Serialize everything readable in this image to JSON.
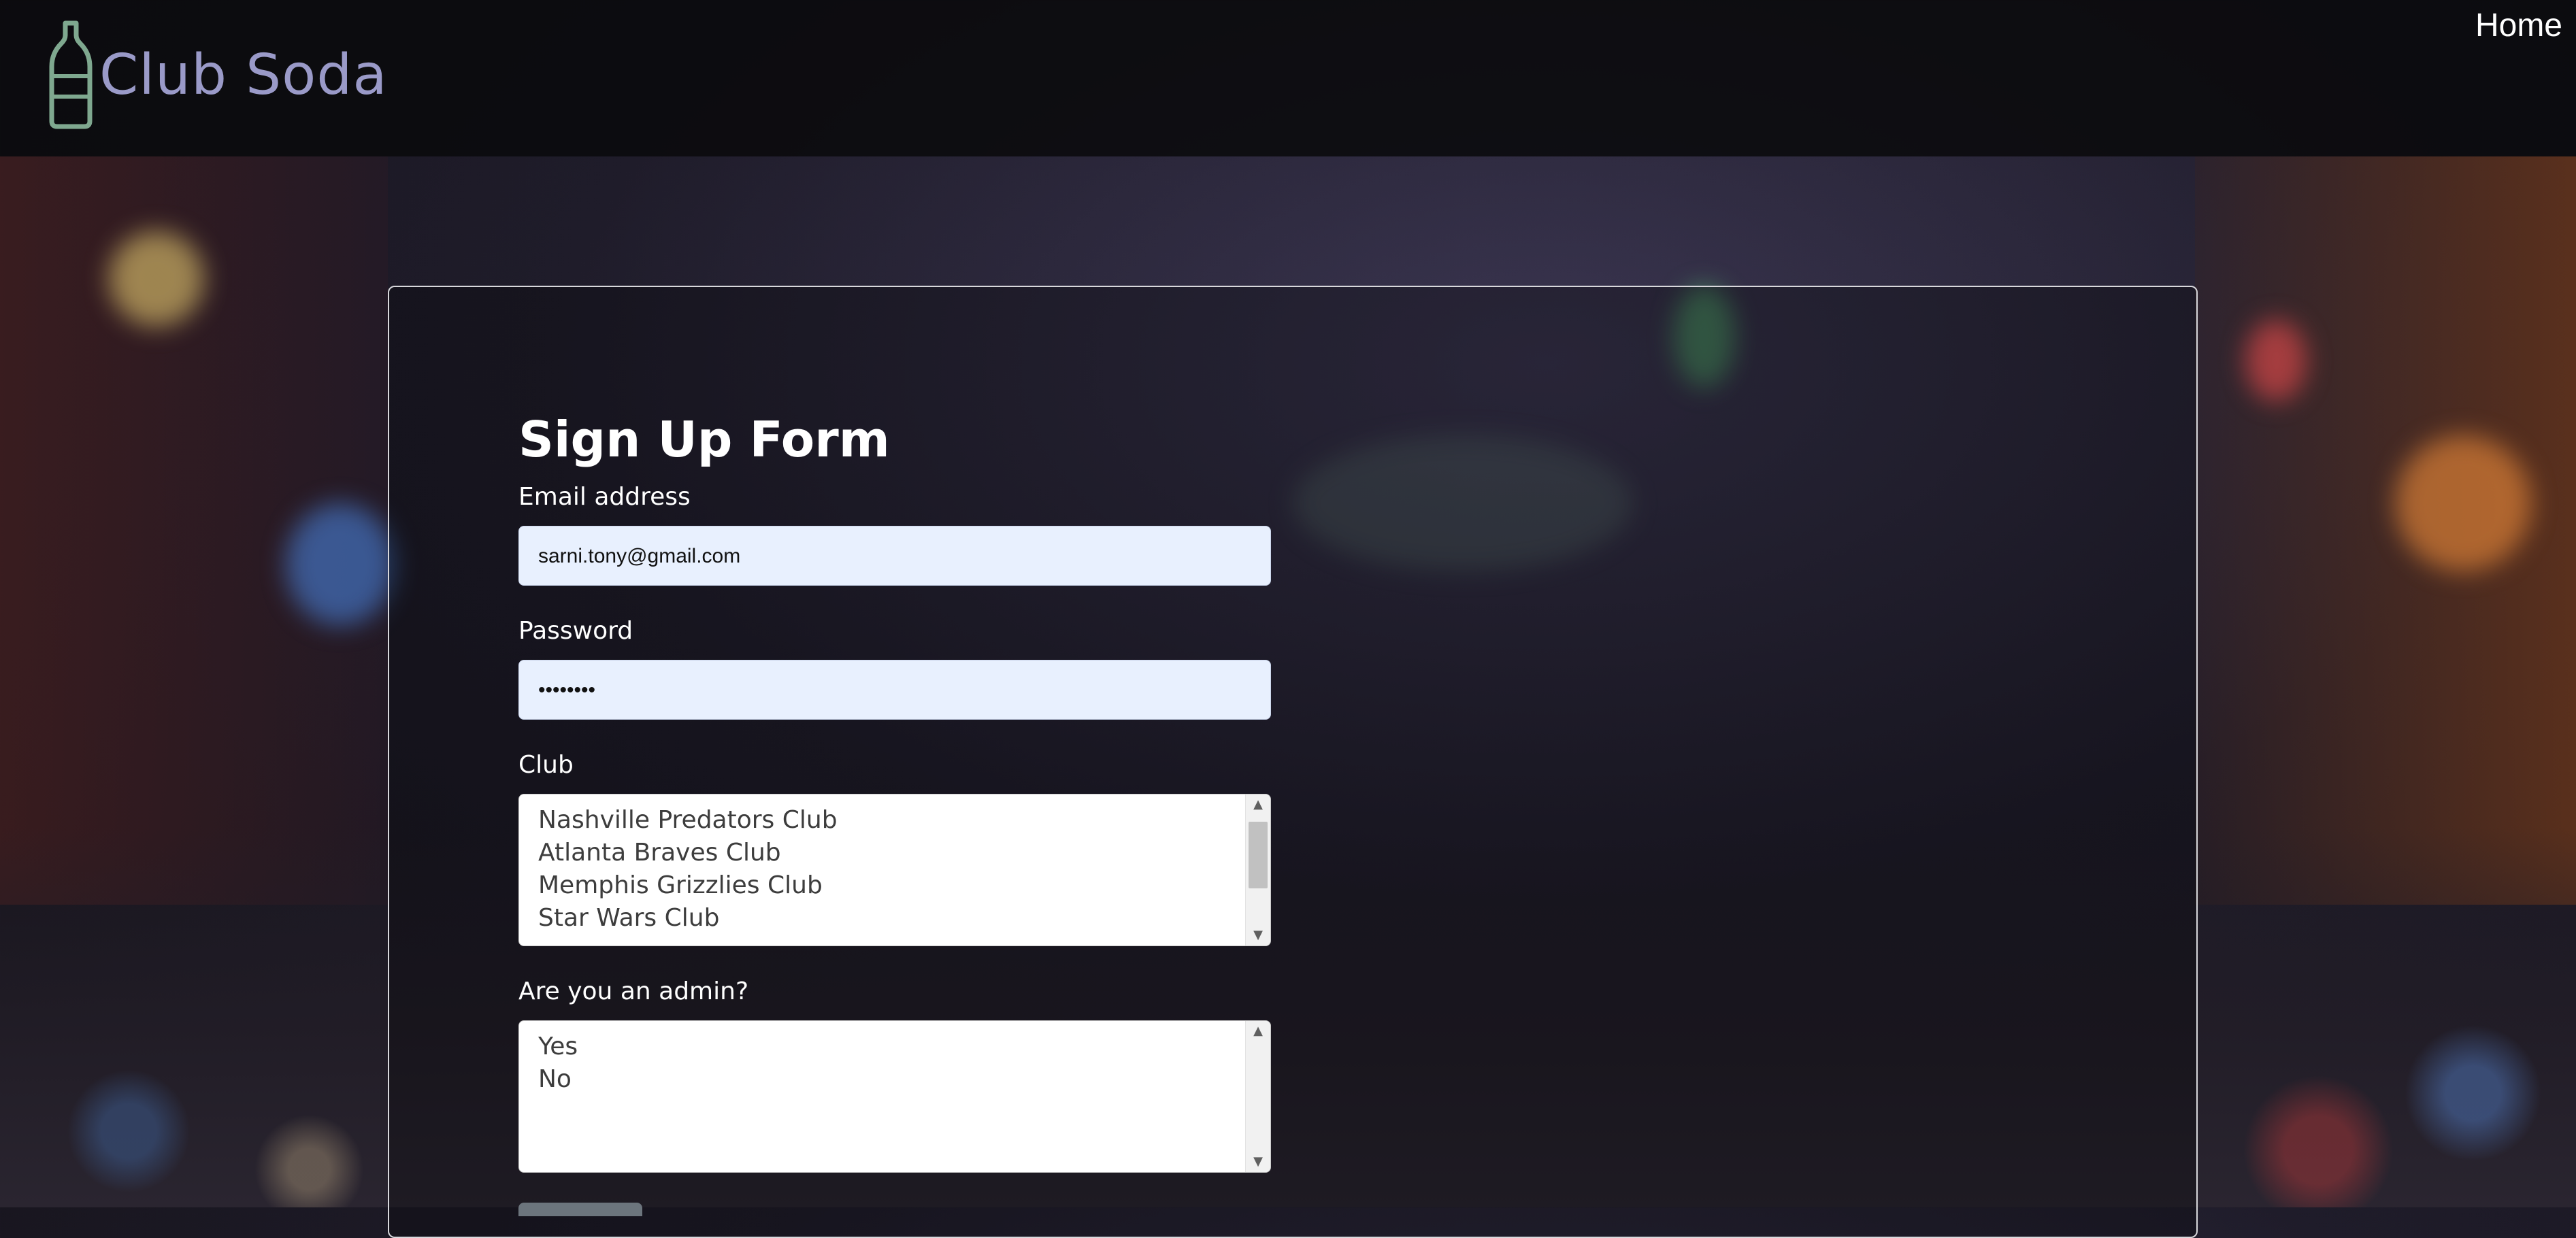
{
  "nav": {
    "brand": "Club Soda",
    "home_label": "Home"
  },
  "form": {
    "title": "Sign Up Form",
    "email": {
      "label": "Email address",
      "value": "sarni.tony@gmail.com"
    },
    "password": {
      "label": "Password",
      "value": "••••••••"
    },
    "club": {
      "label": "Club",
      "options": [
        "Nashville Predators Club",
        "Atlanta Braves Club",
        "Memphis Grizzlies Club",
        "Star Wars Club"
      ]
    },
    "admin": {
      "label": "Are you an admin?",
      "options": [
        "Yes",
        "No"
      ]
    }
  },
  "colors": {
    "brand_text": "#9a9ac8",
    "logo_stroke": "#7fa88f",
    "input_bg": "#e8f0fe"
  }
}
